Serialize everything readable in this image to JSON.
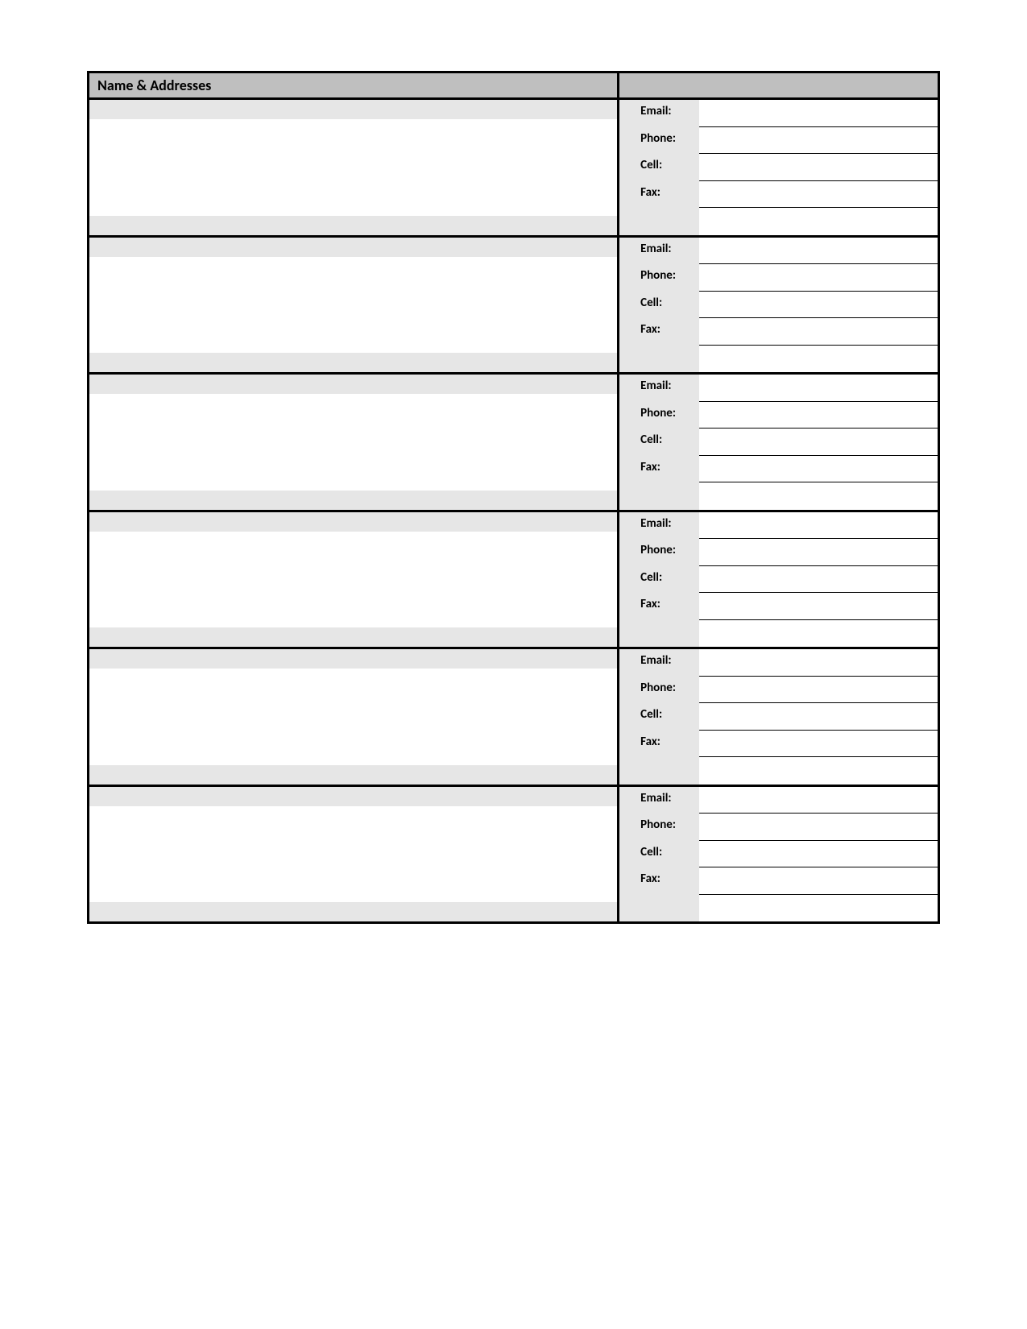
{
  "header": {
    "title": "Name & Addresses"
  },
  "labels": {
    "email": "Email:",
    "phone": "Phone:",
    "cell": "Cell:",
    "fax": "Fax:",
    "blank": ""
  },
  "entries": [
    {
      "name": "",
      "address": "",
      "email": "",
      "phone": "",
      "cell": "",
      "fax": "",
      "extra": ""
    },
    {
      "name": "",
      "address": "",
      "email": "",
      "phone": "",
      "cell": "",
      "fax": "",
      "extra": ""
    },
    {
      "name": "",
      "address": "",
      "email": "",
      "phone": "",
      "cell": "",
      "fax": "",
      "extra": ""
    },
    {
      "name": "",
      "address": "",
      "email": "",
      "phone": "",
      "cell": "",
      "fax": "",
      "extra": ""
    },
    {
      "name": "",
      "address": "",
      "email": "",
      "phone": "",
      "cell": "",
      "fax": "",
      "extra": ""
    },
    {
      "name": "",
      "address": "",
      "email": "",
      "phone": "",
      "cell": "",
      "fax": "",
      "extra": ""
    }
  ]
}
